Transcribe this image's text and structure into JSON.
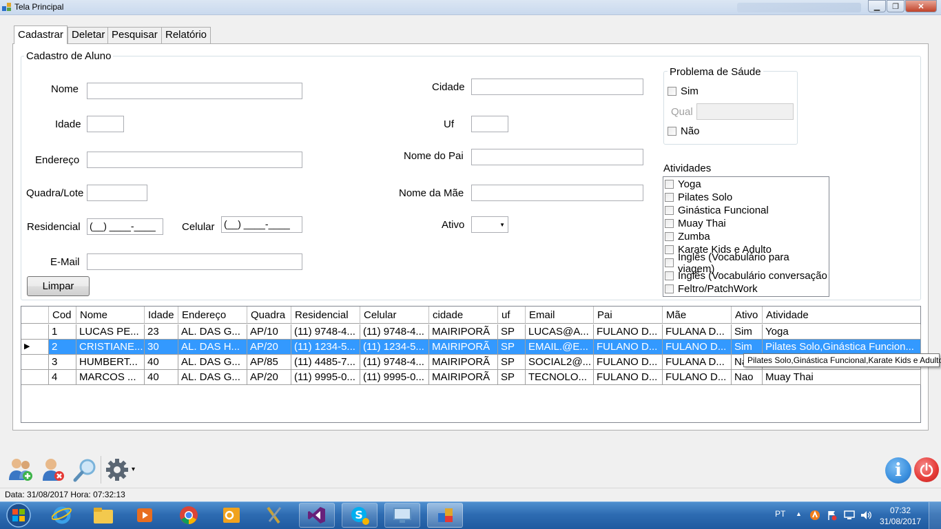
{
  "window": {
    "title": "Tela Principal",
    "minimize": "▁",
    "maximize": "❐",
    "close": "✕"
  },
  "tabs": [
    "Cadastrar",
    "Deletar",
    "Pesquisar",
    "Relatório"
  ],
  "form": {
    "group_title": "Cadastro de Aluno",
    "labels": {
      "nome": "Nome",
      "idade": "Idade",
      "endereco": "Endereço",
      "quadra": "Quadra/Lote",
      "residencial": "Residencial",
      "celular": "Celular",
      "email": "E-Mail",
      "cidade": "Cidade",
      "uf": "Uf",
      "pai": "Nome do Pai",
      "mae": "Nome da Mãe",
      "ativo": "Ativo"
    },
    "values": {
      "nome": "",
      "idade": "",
      "endereco": "",
      "quadra": "",
      "email": "",
      "cidade": "",
      "uf": "",
      "pai": "",
      "mae": "",
      "ativo": ""
    },
    "residencial_mask": "(__) ____-____",
    "celular_mask": "(__) ____-____",
    "clear_button": "Limpar"
  },
  "health": {
    "title": "Problema de Sáude",
    "yes": "Sim",
    "qual": "Qual",
    "qual_value": "",
    "no": "Não"
  },
  "activities": {
    "title": "Atividades",
    "items": [
      "Yoga",
      "Pilates Solo",
      "Ginástica Funcional",
      "Muay Thai",
      "Zumba",
      "Karate Kids e Adulto",
      "Inglês (Vocabulário para viagem)",
      "Inglês (Vocabulário conversação",
      "Feltro/PatchWork"
    ]
  },
  "grid": {
    "columns": [
      "Cod",
      "Nome",
      "Idade",
      "Endereço",
      "Quadra",
      "Residencial",
      "Celular",
      "cidade",
      "uf",
      "Email",
      "Pai",
      "Mãe",
      "Ativo",
      "Atividade"
    ],
    "rows": [
      [
        "1",
        "LUCAS PE...",
        "23",
        "AL. DAS G...",
        "AP/10",
        "(11) 9748-4...",
        "(11) 9748-4...",
        "MAIRIPORÃ",
        "SP",
        "LUCAS@A...",
        "FULANO D...",
        "FULANA D...",
        "Sim",
        "Yoga"
      ],
      [
        "2",
        "CRISTIANE...",
        "30",
        "AL. DAS H...",
        "AP/20",
        "(11) 1234-5...",
        "(11) 1234-5...",
        "MAIRIPORÃ",
        "SP",
        "EMAIL.@E...",
        "FULANO D...",
        "FULANO D...",
        "Sim",
        "Pilates Solo,Ginástica Funcion..."
      ],
      [
        "3",
        "HUMBERT...",
        "40",
        "AL. DAS G...",
        "AP/85",
        "(11) 4485-7...",
        "(11) 9748-4...",
        "MAIRIPORÃ",
        "SP",
        "SOCIAL2@...",
        "FULANO D...",
        "FULANA D...",
        "Na",
        ""
      ],
      [
        "4",
        "MARCOS ...",
        "40",
        "AL. DAS G...",
        "AP/20",
        "(11) 9995-0...",
        "(11) 9995-0...",
        "MAIRIPORÃ",
        "SP",
        "TECNOLO...",
        "FULANO D...",
        "FULANO D...",
        "Nao",
        "Muay Thai"
      ]
    ],
    "selected_row": 1,
    "row_pointer": "▶",
    "tooltip": "Pilates Solo,Ginástica Funcional,Karate Kids e Adulto"
  },
  "toolbar": {
    "settings_caret": "▾"
  },
  "status": {
    "text": "Data: 31/08/2017 Hora: 07:32:13"
  },
  "taskbar": {
    "lang": "PT",
    "time": "07:32",
    "date": "31/08/2017"
  },
  "colors": {
    "selection": "#3399ff",
    "info": "#3a8fde",
    "power": "#e53935"
  }
}
